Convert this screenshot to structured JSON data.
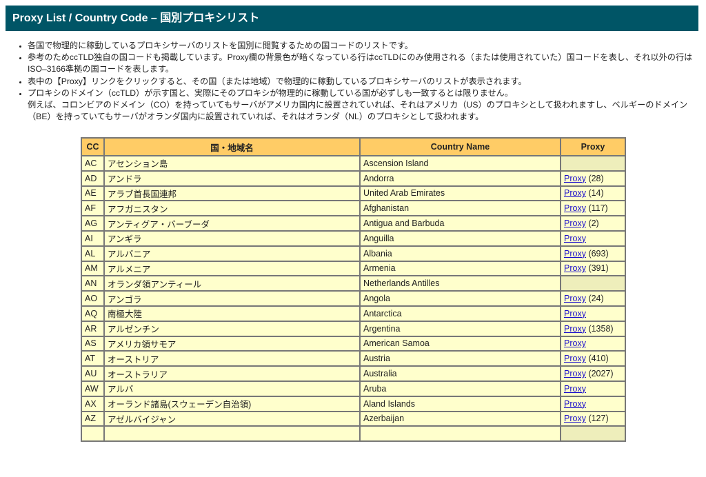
{
  "header": {
    "title": "Proxy List / Country Code  –  国別プロキシリスト"
  },
  "notes": [
    "各国で物理的に稼動しているプロキシサーバのリストを国別に閲覧するための国コードのリストです。",
    "参考のためccTLD独自の国コードも掲載しています。Proxy欄の背景色が暗くなっている行はccTLDにのみ使用される（または使用されていた）国コードを表し、それ以外の行はISO–3166準拠の国コードを表します。",
    "表中の【Proxy】リンクをクリックすると、その国（または地域）で物理的に稼動しているプロキシサーバのリストが表示されます。",
    "プロキシのドメイン（ccTLD）が示す国と、実際にそのプロキシが物理的に稼動している国が必ずしも一致するとは限りません。\n例えば、コロンビアのドメイン（CO）を持っていてもサーバがアメリカ国内に設置されていれば、それはアメリカ（US）のプロキシとして扱われますし、ベルギーのドメイン（BE）を持っていてもサーバがオランダ国内に設置されていれば、それはオランダ（NL）のプロキシとして扱われます。"
  ],
  "table": {
    "columns": [
      "CC",
      "国・地域名",
      "Country Name",
      "Proxy"
    ],
    "link_label": "Proxy",
    "colors": {
      "header_bg": "#ffcc66",
      "row_bg": "#ffffcc",
      "cctld_only_bg": "#eeeebb",
      "link": "#1a0dcc"
    },
    "rows": [
      {
        "cc": "AC",
        "jp": "アセンション島",
        "en": "Ascension Island",
        "proxy": false,
        "count": null
      },
      {
        "cc": "AD",
        "jp": "アンドラ",
        "en": "Andorra",
        "proxy": true,
        "count": "(28)"
      },
      {
        "cc": "AE",
        "jp": "アラブ首長国連邦",
        "en": "United Arab Emirates",
        "proxy": true,
        "count": "(14)"
      },
      {
        "cc": "AF",
        "jp": "アフガニスタン",
        "en": "Afghanistan",
        "proxy": true,
        "count": "(117)"
      },
      {
        "cc": "AG",
        "jp": "アンティグア・バーブーダ",
        "en": "Antigua and Barbuda",
        "proxy": true,
        "count": "(2)"
      },
      {
        "cc": "AI",
        "jp": "アンギラ",
        "en": "Anguilla",
        "proxy": true,
        "count": null
      },
      {
        "cc": "AL",
        "jp": "アルバニア",
        "en": "Albania",
        "proxy": true,
        "count": "(693)"
      },
      {
        "cc": "AM",
        "jp": "アルメニア",
        "en": "Armenia",
        "proxy": true,
        "count": "(391)"
      },
      {
        "cc": "AN",
        "jp": "オランダ領アンティール",
        "en": "Netherlands Antilles",
        "proxy": false,
        "count": null
      },
      {
        "cc": "AO",
        "jp": "アンゴラ",
        "en": "Angola",
        "proxy": true,
        "count": "(24)"
      },
      {
        "cc": "AQ",
        "jp": "南極大陸",
        "en": "Antarctica",
        "proxy": true,
        "count": null
      },
      {
        "cc": "AR",
        "jp": "アルゼンチン",
        "en": "Argentina",
        "proxy": true,
        "count": "(1358)"
      },
      {
        "cc": "AS",
        "jp": "アメリカ領サモア",
        "en": "American Samoa",
        "proxy": true,
        "count": null
      },
      {
        "cc": "AT",
        "jp": "オーストリア",
        "en": "Austria",
        "proxy": true,
        "count": "(410)"
      },
      {
        "cc": "AU",
        "jp": "オーストラリア",
        "en": "Australia",
        "proxy": true,
        "count": "(2027)"
      },
      {
        "cc": "AW",
        "jp": "アルバ",
        "en": "Aruba",
        "proxy": true,
        "count": null
      },
      {
        "cc": "AX",
        "jp": "オーランド諸島(スウェーデン自治領)",
        "en": "Aland Islands",
        "proxy": true,
        "count": null
      },
      {
        "cc": "AZ",
        "jp": "アゼルバイジャン",
        "en": "Azerbaijan",
        "proxy": true,
        "count": "(127)"
      },
      {
        "cc": "",
        "jp": "",
        "en": "",
        "proxy": false,
        "count": null
      }
    ]
  }
}
